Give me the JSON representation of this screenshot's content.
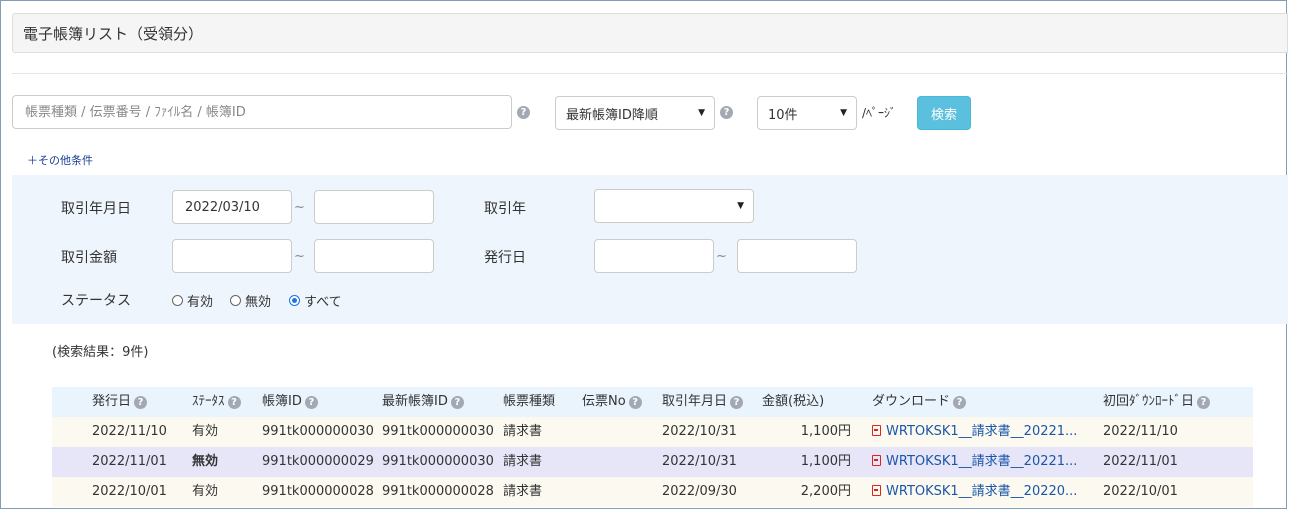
{
  "title": "電子帳簿リスト（受領分）",
  "search": {
    "placeholder": "帳票種類 / 伝票番号 / ﾌｧｲﾙ名 / 帳簿ID",
    "sort_value": "最新帳簿ID降順",
    "per_page_value": "10件",
    "per_page_suffix": "/ﾍﾟｰｼﾞ",
    "search_button": "検索",
    "more_conditions": "＋その他条件"
  },
  "filters": {
    "date_label": "取引年月日",
    "date_from": "2022/03/10",
    "date_to": "",
    "year_label": "取引年",
    "year_value": "",
    "amount_label": "取引金額",
    "amount_from": "",
    "amount_to": "",
    "issue_label": "発行日",
    "issue_from": "",
    "issue_to": "",
    "tilde": "~",
    "status_label": "ステータス",
    "status_options": [
      "有効",
      "無効",
      "すべて"
    ],
    "status_selected": "すべて"
  },
  "result_text": "(検索結果：9件)",
  "table": {
    "headers": [
      "発行日",
      "ｽﾃｰﾀｽ",
      "帳簿ID",
      "最新帳簿ID",
      "帳票種類",
      "伝票No",
      "取引年月日",
      "金額(税込)",
      "ダウンロード",
      "初回ﾀﾞｳﾝﾛｰﾄﾞ日"
    ],
    "rows": [
      [
        "2022/11/10",
        "有効",
        "991tk000000030",
        "991tk000000030",
        "請求書",
        "",
        "2022/10/31",
        "1,100円",
        "WRTOKSK1__請求書__20221...",
        "2022/11/10"
      ],
      [
        "2022/11/01",
        "無効",
        "991tk000000029",
        "991tk000000030",
        "請求書",
        "",
        "2022/10/31",
        "1,100円",
        "WRTOKSK1__請求書__20221...",
        "2022/11/01"
      ],
      [
        "2022/10/01",
        "有効",
        "991tk000000028",
        "991tk000000028",
        "請求書",
        "",
        "2022/09/30",
        "2,200円",
        "WRTOKSK1__請求書__20220...",
        "2022/10/01"
      ]
    ]
  },
  "icons": {
    "help": "question-circle-icon",
    "pdf": "pdf-file-icon"
  },
  "colors": {
    "search_button": "#5bc0de",
    "link": "#1a55a8",
    "pdf": "#d9241f",
    "panel": "#eef5fc"
  }
}
